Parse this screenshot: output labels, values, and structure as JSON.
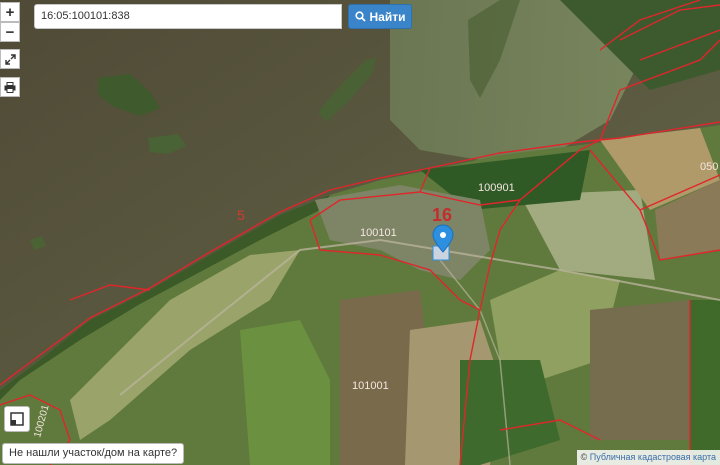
{
  "search": {
    "value": "16:05:100101:838",
    "button_label": "Найти"
  },
  "controls": {
    "zoom_in": "+",
    "zoom_out": "−"
  },
  "map": {
    "labels": {
      "quarter_left": "100101",
      "quarter_top": "100901",
      "quarter_bottom": "101001",
      "left_edge": "100201",
      "right_edge": "050",
      "region": "16",
      "district": "5"
    }
  },
  "footer": {
    "not_found_text": "Не нашли участок/дом на карте?",
    "attribution_symbol": "©",
    "attribution_text": "Публичная кадастровая карта"
  },
  "colors": {
    "boundary": "#e0262b",
    "marker": "#2d8fe0",
    "accent": "#3a84c9"
  }
}
